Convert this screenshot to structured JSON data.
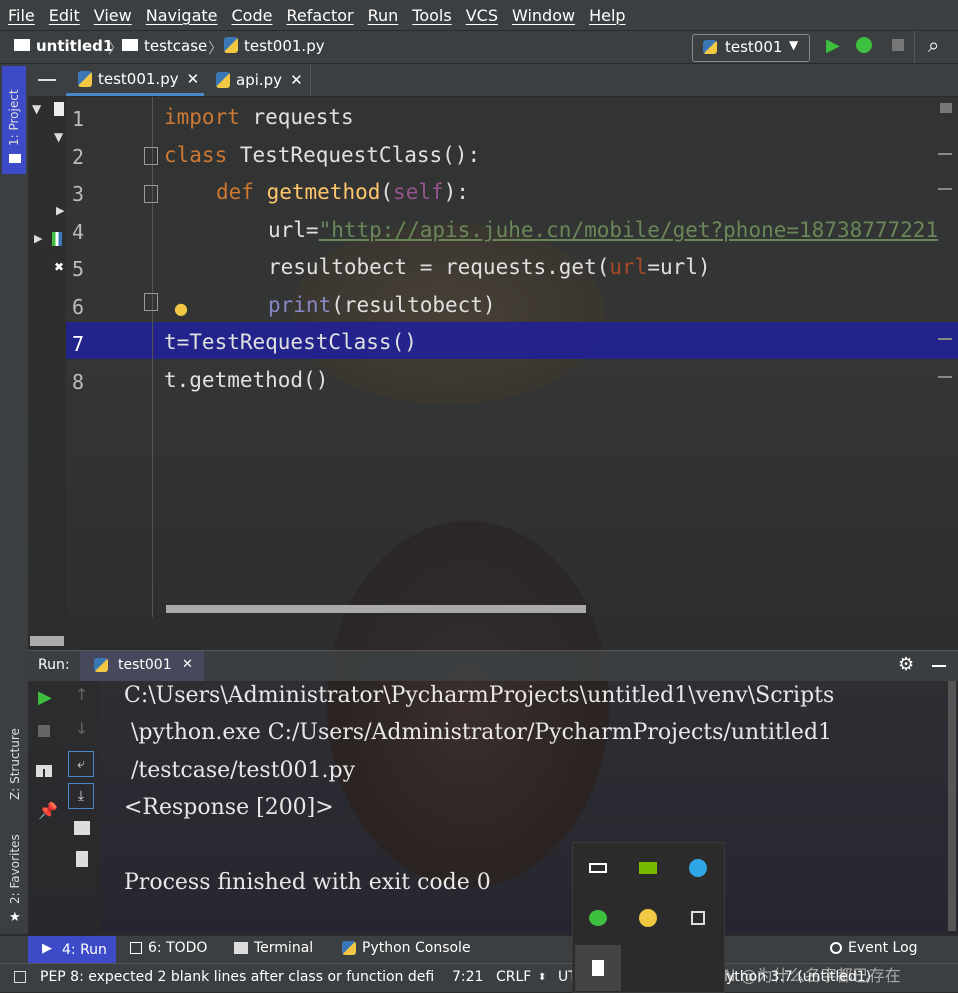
{
  "menu": [
    "File",
    "Edit",
    "View",
    "Navigate",
    "Code",
    "Refactor",
    "Run",
    "Tools",
    "VCS",
    "Window",
    "Help"
  ],
  "breadcrumb": {
    "project": "untitled1",
    "folder": "testcase",
    "file": "test001.py"
  },
  "run_config": "test001",
  "left_tabs": {
    "project": "1: Project",
    "structure": "Z: Structure",
    "favorites": "2: Favorites"
  },
  "tabs": [
    {
      "label": "test001.py"
    },
    {
      "label": "api.py"
    }
  ],
  "line_numbers": [
    "1",
    "2",
    "3",
    "4",
    "5",
    "6",
    "7",
    "8"
  ],
  "code": {
    "l1_kw": "import",
    "l1_rest": " requests",
    "l2_kw": "class",
    "l2_name": " TestRequestClass",
    "l2_rest": "():",
    "l3_kw": "def",
    "l3_name": "getmethod",
    "l3_open": "(",
    "l3_self": "self",
    "l3_close": "):",
    "l4_a": "url=",
    "l4_str": "\"http://apis.juhe.cn/mobile/get?phone=18738777221",
    "l5_a": "resultobect = requests.get(",
    "l5_param": "url",
    "l5_b": "=url)",
    "l6_builtin": "print",
    "l6_rest": "(resultobect)",
    "l7": "t=TestRequestClass()",
    "l8": "t.getmethod()"
  },
  "run": {
    "label": "Run:",
    "tab": "test001"
  },
  "console": [
    "C:\\Users\\Administrator\\PycharmProjects\\untitled1\\venv\\Scripts",
    " \\python.exe C:/Users/Administrator/PycharmProjects/untitled1",
    " /testcase/test001.py",
    "<Response [200]>",
    "",
    "Process finished with exit code 0"
  ],
  "tool_tabs": {
    "run": "4: Run",
    "todo": "6: TODO",
    "terminal": "Terminal",
    "python_console": "Python Console",
    "event_log": "Event Log"
  },
  "status": {
    "message": "PEP 8: expected 2 blank lines after class or function defi",
    "position": "7:21",
    "line_sep": "CRLF",
    "encoding": "UT",
    "interpreter": "ython 3.7 (untitled1)",
    "watermark": "CSDN @为什么名字都已存在"
  },
  "colors": {
    "accent": "#4a88c7",
    "selection": "#212196",
    "run_green": "#3fbf3f"
  }
}
